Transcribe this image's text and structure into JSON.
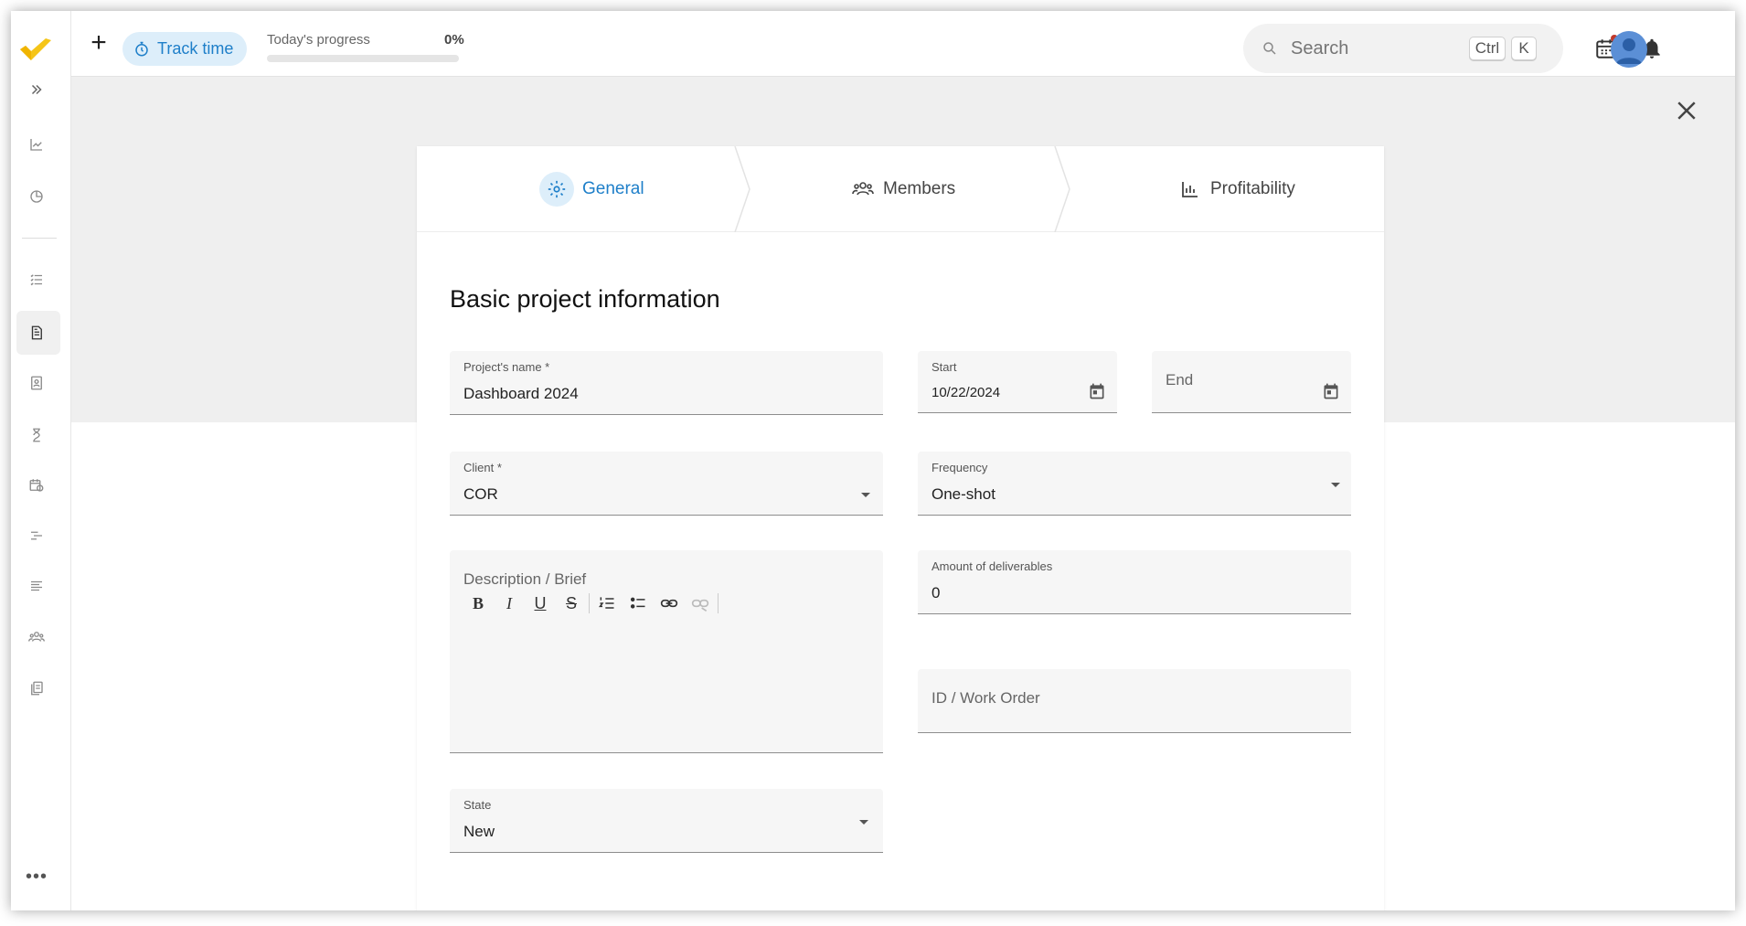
{
  "topbar": {
    "add_label": "+",
    "track_label": "Track time",
    "progress_label": "Today's progress",
    "progress_pct": "0%",
    "progress_value": 0,
    "search_placeholder": "Search",
    "shortcut_ctrl": "Ctrl",
    "shortcut_k": "K"
  },
  "sidebar": {
    "more_label": "•••"
  },
  "steps": [
    {
      "label": "General",
      "icon": "gear-icon",
      "active": true
    },
    {
      "label": "Members",
      "icon": "people-icon",
      "active": false
    },
    {
      "label": "Profitability",
      "icon": "bar-chart-icon",
      "active": false
    }
  ],
  "form": {
    "title": "Basic project information",
    "project_name": {
      "label": "Project's name *",
      "value": "Dashboard 2024"
    },
    "start": {
      "label": "Start",
      "value": "10/22/2024"
    },
    "end": {
      "placeholder": "End"
    },
    "client": {
      "label": "Client *",
      "value": "COR"
    },
    "frequency": {
      "label": "Frequency",
      "value": "One-shot"
    },
    "description": {
      "placeholder": "Description / Brief"
    },
    "deliverables": {
      "label": "Amount of deliverables",
      "value": "0"
    },
    "work_order": {
      "placeholder": "ID / Work Order"
    },
    "state": {
      "label": "State",
      "value": "New"
    }
  },
  "colors": {
    "accent": "#1e7fc9",
    "accent_light": "#ddeefa",
    "logo": "#f5c518"
  }
}
